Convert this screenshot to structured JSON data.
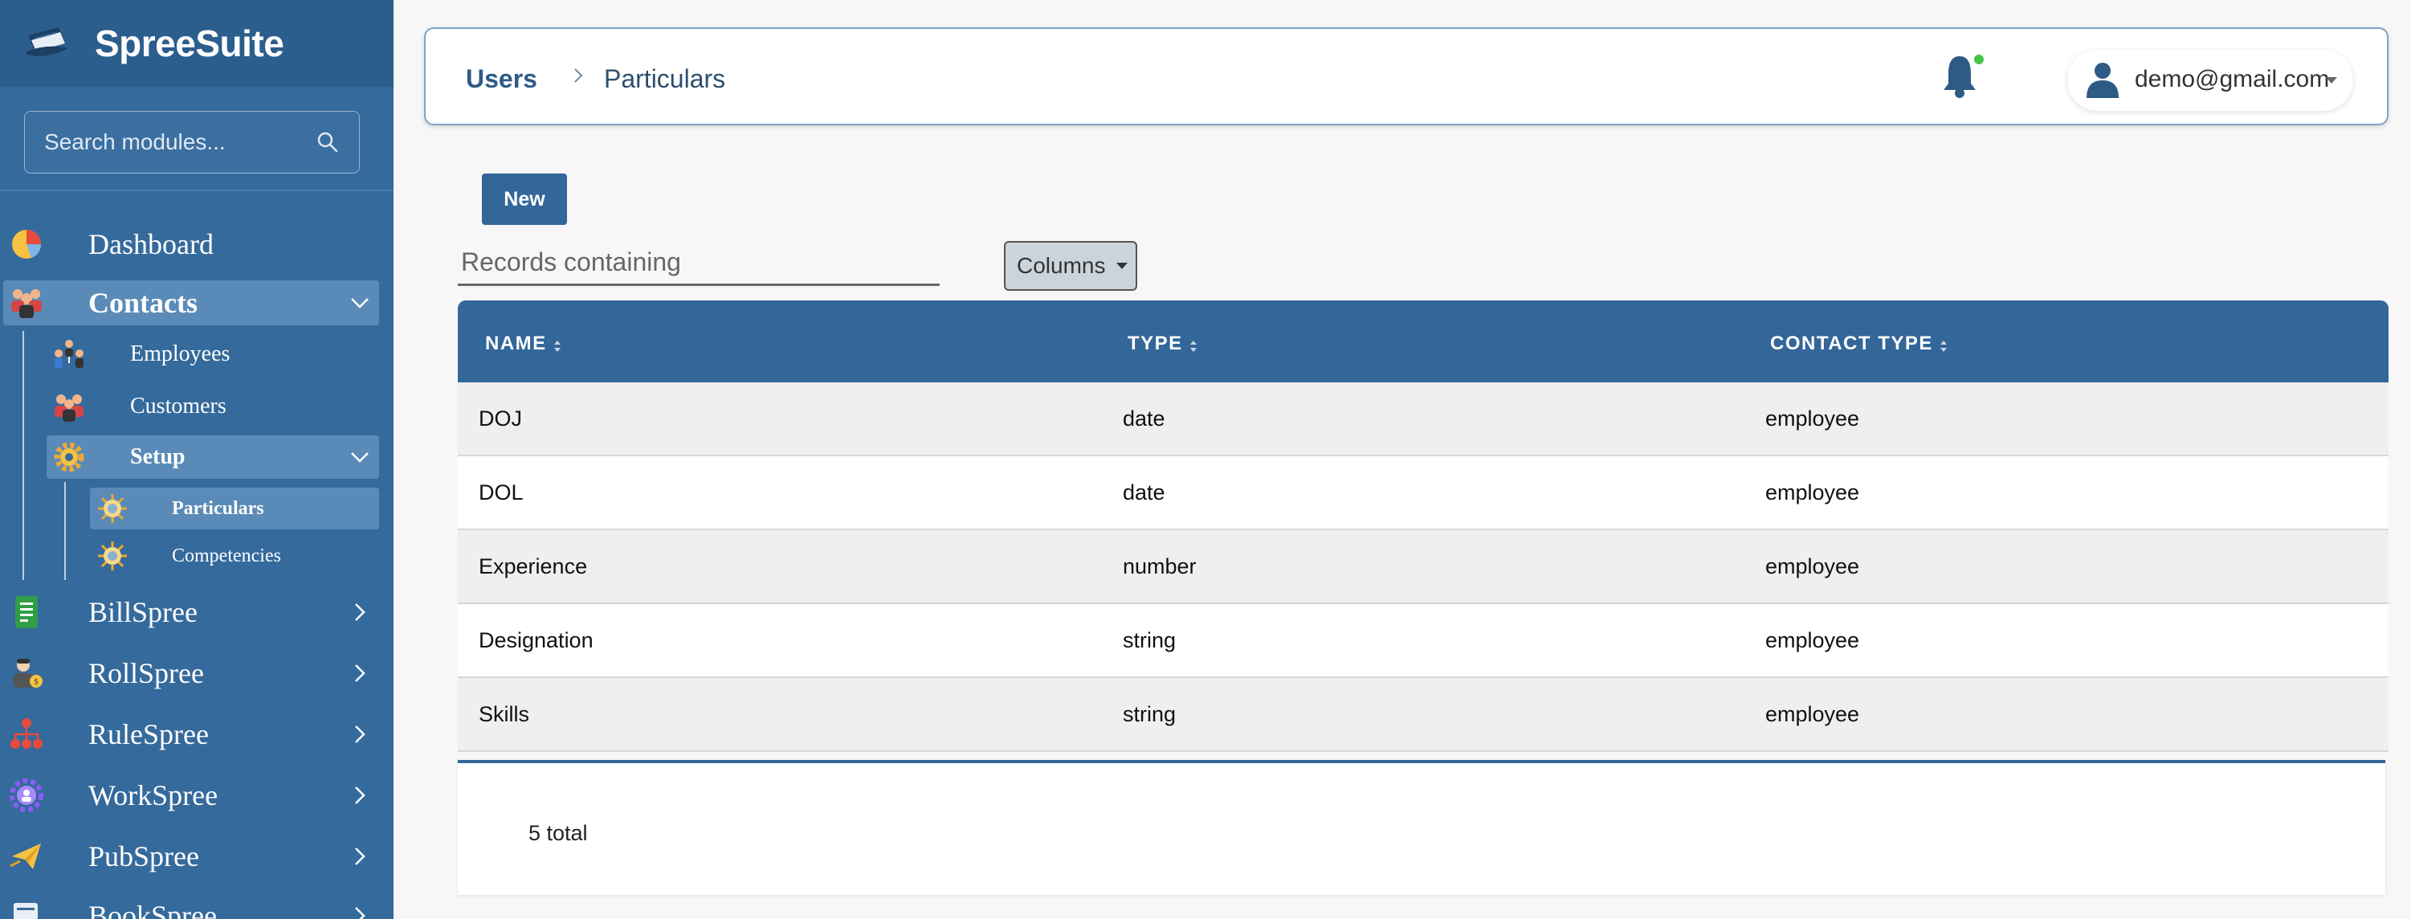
{
  "app": {
    "name": "SpreeSuite"
  },
  "sidebar": {
    "search_placeholder": "Search modules...",
    "items": [
      {
        "label": "Dashboard",
        "icon": "pie-chart-icon"
      },
      {
        "label": "Contacts",
        "icon": "people-group-icon",
        "expanded": true
      },
      {
        "label": "BillSpree",
        "icon": "document-icon"
      },
      {
        "label": "RollSpree",
        "icon": "worker-icon"
      },
      {
        "label": "RuleSpree",
        "icon": "hierarchy-icon"
      },
      {
        "label": "WorkSpree",
        "icon": "gear-people-icon"
      },
      {
        "label": "PubSpree",
        "icon": "paper-plane-icon"
      },
      {
        "label": "BookSpree",
        "icon": "book-icon"
      }
    ],
    "contacts_children": [
      {
        "label": "Employees",
        "icon": "team-icon"
      },
      {
        "label": "Customers",
        "icon": "customers-icon"
      },
      {
        "label": "Setup",
        "icon": "gear-icon",
        "expanded": true
      }
    ],
    "setup_children": [
      {
        "label": "Particulars",
        "icon": "badge-icon",
        "active": true
      },
      {
        "label": "Competencies",
        "icon": "badge-icon"
      }
    ]
  },
  "header": {
    "breadcrumb_root": "Users",
    "breadcrumb_current": "Particulars",
    "user_email": "demo@gmail.com",
    "notification_status_color": "#44c444"
  },
  "toolbar": {
    "new_label": "New",
    "search_placeholder": "Records containing",
    "columns_label": "Columns"
  },
  "table": {
    "columns": [
      "NAME",
      "TYPE",
      "CONTACT TYPE"
    ],
    "rows": [
      [
        "DOJ",
        "date",
        "employee"
      ],
      [
        "DOL",
        "date",
        "employee"
      ],
      [
        "Experience",
        "number",
        "employee"
      ],
      [
        "Designation",
        "string",
        "employee"
      ],
      [
        "Skills",
        "string",
        "employee"
      ]
    ],
    "total_label": "5 total"
  },
  "colors": {
    "sidebar": "#356a9c",
    "primary": "#336699",
    "highlight": "#5a8bb8"
  }
}
